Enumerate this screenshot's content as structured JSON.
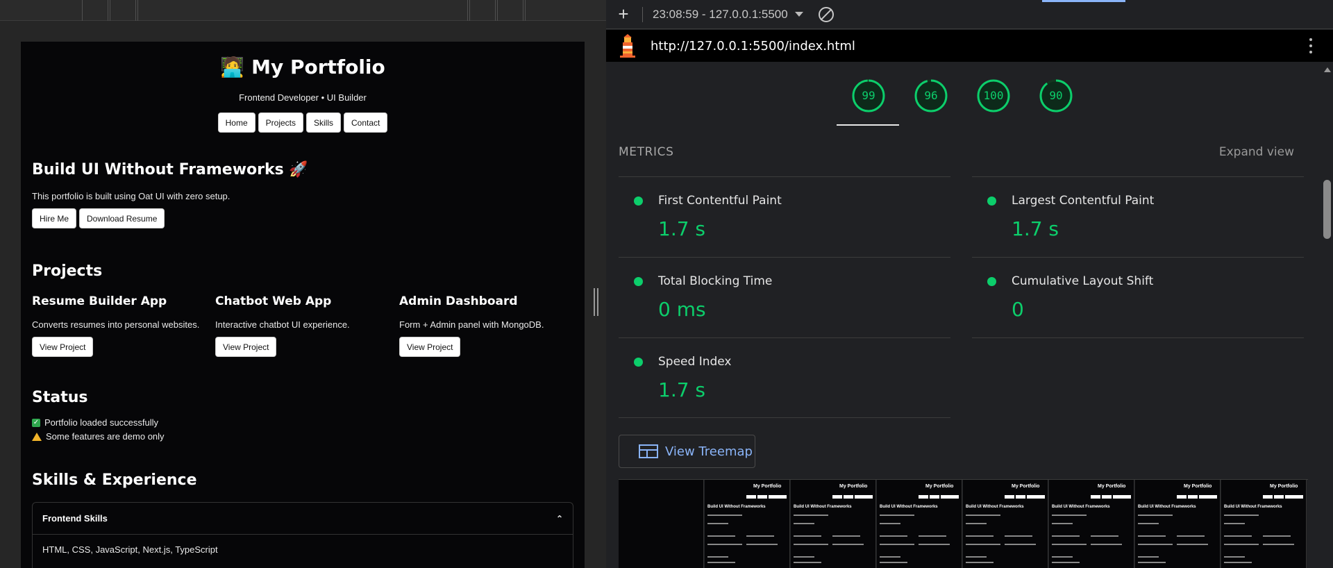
{
  "preview": {
    "title_emoji": "🧑‍💻",
    "title": "My Portfolio",
    "subtitle": "Frontend Developer • UI Builder",
    "nav": [
      "Home",
      "Projects",
      "Skills",
      "Contact"
    ],
    "hero": {
      "heading": "Build UI Without Frameworks 🚀",
      "text": "This portfolio is built using Oat UI with zero setup.",
      "buttons": [
        "Hire Me",
        "Download Resume"
      ]
    },
    "projects": {
      "heading": "Projects",
      "items": [
        {
          "title": "Resume Builder App",
          "desc": "Converts resumes into personal websites.",
          "button": "View Project"
        },
        {
          "title": "Chatbot Web App",
          "desc": "Interactive chatbot UI experience.",
          "button": "View Project"
        },
        {
          "title": "Admin Dashboard",
          "desc": "Form + Admin panel with MongoDB.",
          "button": "View Project"
        }
      ]
    },
    "status": {
      "heading": "Status",
      "lines": [
        "Portfolio loaded successfully",
        "Some features are demo only"
      ]
    },
    "skills": {
      "heading": "Skills & Experience",
      "accordion_title": "Frontend Skills",
      "accordion_body": "HTML, CSS, JavaScript, Next.js, TypeScript"
    }
  },
  "devtools": {
    "session": "23:08:59 - 127.0.0.1:5500",
    "url": "http://127.0.0.1:5500/index.html",
    "scores": [
      99,
      96,
      100,
      90
    ],
    "score_color": "#0cce6b",
    "metrics_title": "METRICS",
    "expand_label": "Expand view",
    "metrics": [
      {
        "label": "First Contentful Paint",
        "value": "1.7 s"
      },
      {
        "label": "Largest Contentful Paint",
        "value": "1.7 s"
      },
      {
        "label": "Total Blocking Time",
        "value": "0 ms"
      },
      {
        "label": "Cumulative Layout Shift",
        "value": "0"
      },
      {
        "label": "Speed Index",
        "value": "1.7 s"
      }
    ],
    "treemap_label": "View Treemap",
    "filmstrip": {
      "frame_title": "My Portfolio",
      "frame_heading": "Build UI Without Frameworks"
    }
  },
  "icons": {
    "plus": "plus-icon",
    "dropdown": "caret-down-icon",
    "clear": "block-icon",
    "logo": "lighthouse-icon",
    "menu": "kebab-menu-icon",
    "treemap": "treemap-icon",
    "check": "checkmark-icon",
    "warning": "warning-icon",
    "chevron": "chevron-up-icon"
  }
}
